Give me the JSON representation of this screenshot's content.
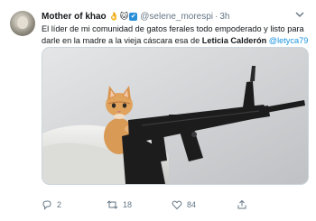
{
  "tweet": {
    "display_name": "Mother of khao",
    "name_emojis": [
      "👌",
      "🐱",
      "✔"
    ],
    "handle": "@selene_morespi",
    "separator": "·",
    "time": "3h",
    "text_part1": "El líder de mi comunidad de gatos ferales todo empoderado y listo para darle en la madre a la vieja cáscara esa de ",
    "text_bold": "Leticia Calderón",
    "text_mention": "@letyca79",
    "caret_icon": "chevron-down-icon"
  },
  "actions": {
    "reply_count": "2",
    "retweet_count": "18",
    "like_count": "84"
  },
  "colors": {
    "link": "#1b95e0",
    "secondary_text": "#657786",
    "border": "#ccd6dd"
  }
}
